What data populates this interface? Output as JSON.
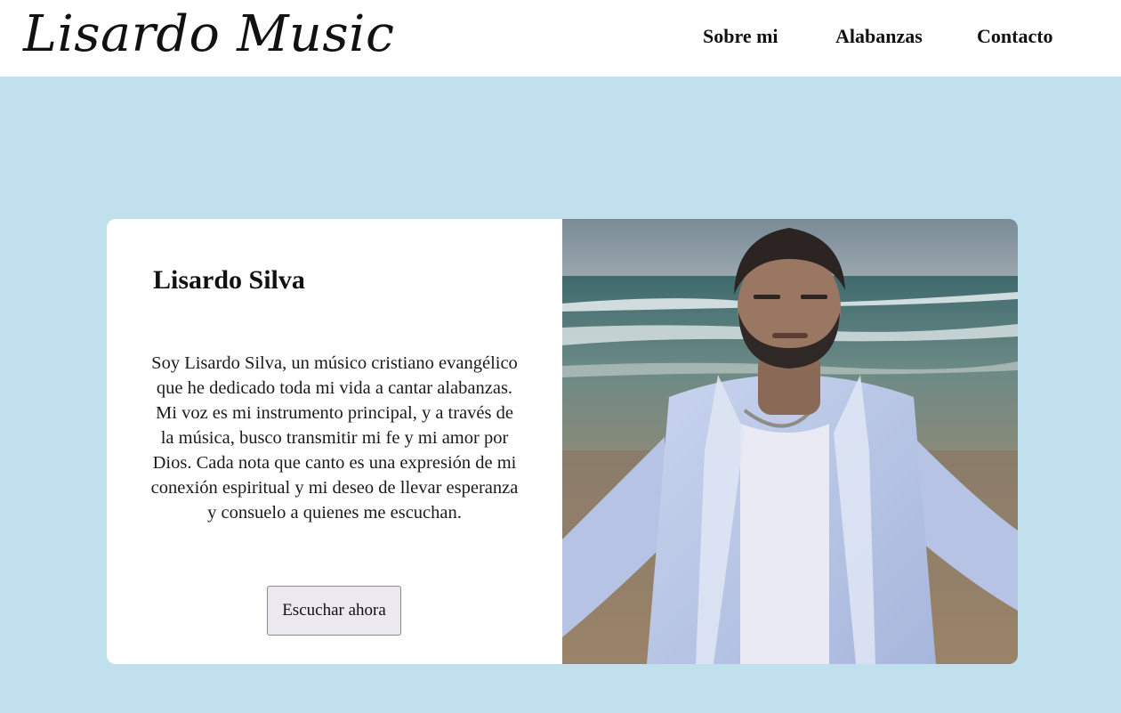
{
  "header": {
    "logo": "Lisardo Music",
    "nav": [
      {
        "label": "Sobre mi"
      },
      {
        "label": "Alabanzas"
      },
      {
        "label": "Contacto"
      }
    ]
  },
  "hero": {
    "title": "Lisardo Silva",
    "description": "Soy Lisardo Silva, un músico cristiano evangélico que he dedicado toda mi vida a cantar alabanzas. Mi voz es mi instrumento principal, y a través de la música, busco transmitir mi fe y mi amor por Dios. Cada nota que canto es una expresión de mi conexión espiritual y mi deseo de llevar esperanza y consuelo a quienes me escuchan.",
    "button_label": "Escuchar ahora"
  },
  "colors": {
    "page_background": "#bfe0ec",
    "header_background": "#ffffff",
    "card_background": "#ffffff",
    "button_background": "#ebe9ef"
  }
}
